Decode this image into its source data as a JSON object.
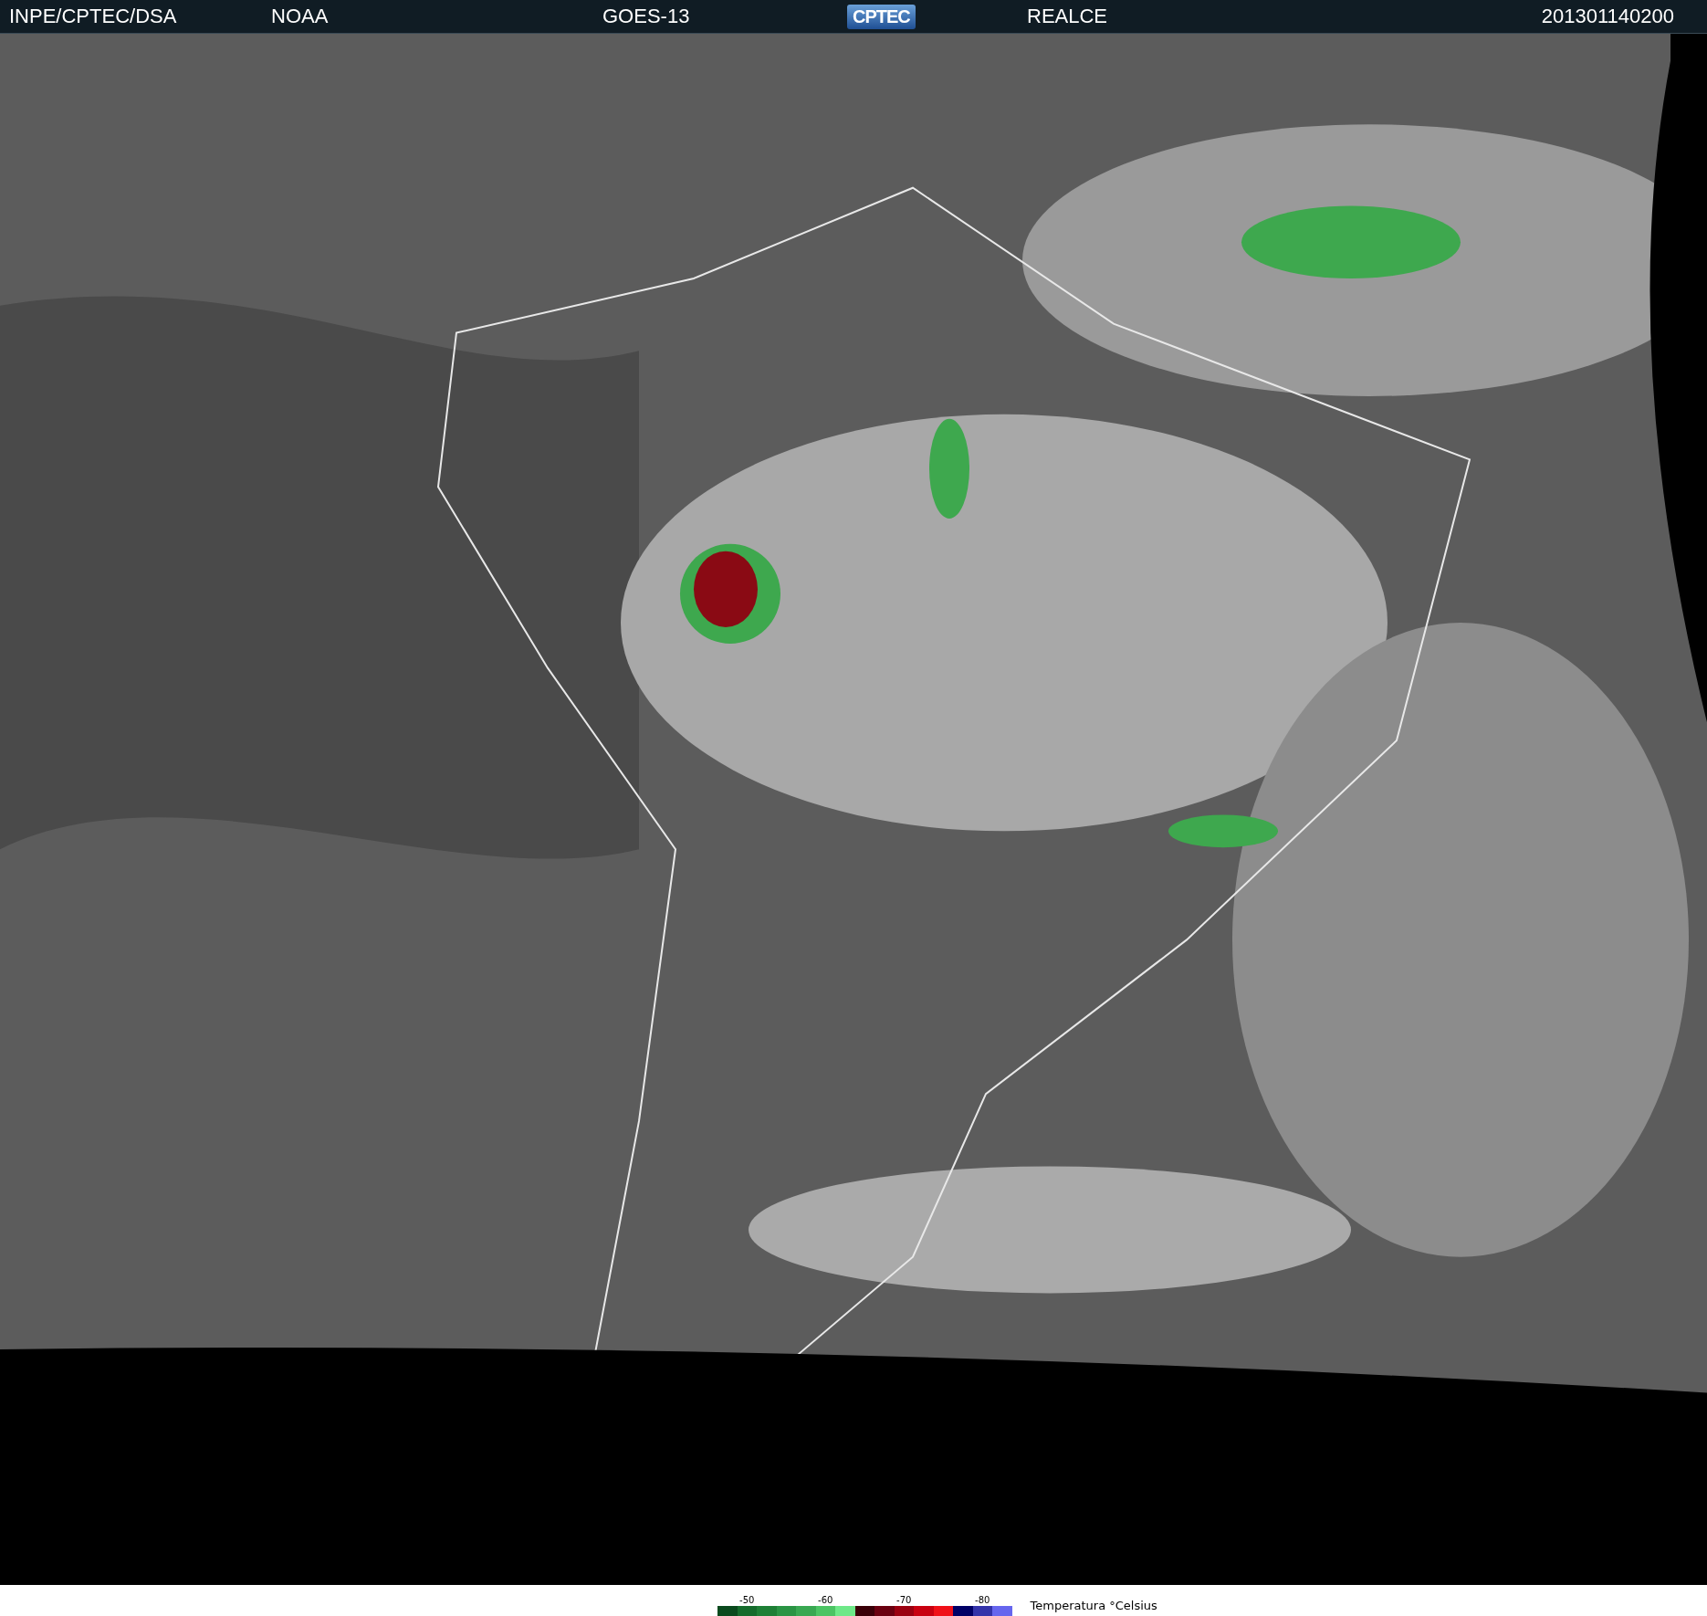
{
  "header": [
    {
      "kind": "text",
      "text": "INPE/CPTEC/DSA"
    },
    {
      "kind": "text",
      "text": "NOAA"
    },
    {
      "kind": "text",
      "text": "GOES-13"
    },
    {
      "kind": "logo",
      "text": "CPTEC"
    },
    {
      "kind": "text",
      "text": "REALCE"
    },
    {
      "kind": "text",
      "text": "201301140200"
    }
  ],
  "legend": {
    "title": "Temperatura °Celsius",
    "swatches": [
      {
        "color": "#0a4a1e"
      },
      {
        "color": "#156b2c",
        "label": "-50"
      },
      {
        "color": "#1e7f36"
      },
      {
        "color": "#2a9444"
      },
      {
        "color": "#39a852"
      },
      {
        "color": "#4cc464",
        "label": "-60"
      },
      {
        "color": "#6ee888"
      },
      {
        "color": "#3a0008"
      },
      {
        "color": "#6a0010"
      },
      {
        "color": "#9a0010",
        "label": "-70"
      },
      {
        "color": "#c80010"
      },
      {
        "color": "#f01018"
      },
      {
        "color": "#000066"
      },
      {
        "color": "#3333aa",
        "label": "-80"
      },
      {
        "color": "#6666ee"
      }
    ]
  }
}
